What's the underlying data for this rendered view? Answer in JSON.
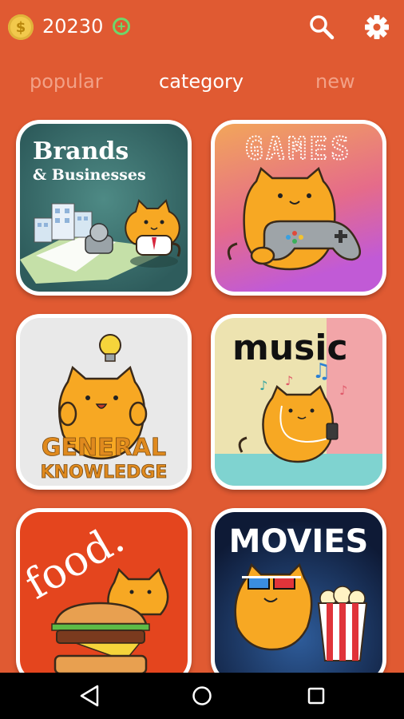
{
  "header": {
    "coin_symbol": "$",
    "coins": "20230",
    "add_symbol": "+"
  },
  "tabs": [
    {
      "label": "popular"
    },
    {
      "label": "category"
    },
    {
      "label": "new"
    }
  ],
  "categories": [
    {
      "title_line1": "Brands",
      "title_line2": "& Businesses"
    },
    {
      "title": "GAMES"
    },
    {
      "title_line1": "GENERAL",
      "title_line2": "KNOWLEDGE"
    },
    {
      "title": "music"
    },
    {
      "title": "food."
    },
    {
      "title": "MOVIES"
    }
  ],
  "colors": {
    "background": "#E05A32",
    "tab_inactive": "#F2A187",
    "tab_active": "#FFFFFF",
    "coin": "#F2C94C",
    "add": "#6FD66A",
    "cat_orange": "#F7A823"
  },
  "icons": {
    "coin": "coin-icon",
    "add": "add-coins-icon",
    "search": "search-icon",
    "settings": "gear-icon",
    "back": "back-icon",
    "home": "home-icon",
    "recents": "recents-icon"
  }
}
